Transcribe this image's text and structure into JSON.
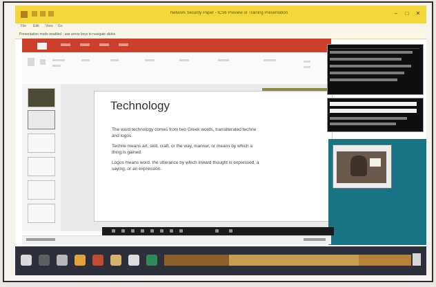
{
  "window": {
    "title": "Network Security Paper - ICS6 Preview or Training Presentation",
    "buttons": [
      "–",
      "□",
      "✕"
    ]
  },
  "menu": [
    "File",
    "Edit",
    "View",
    "Go"
  ],
  "infobar": {
    "text": "Presentation mode enabled - use arrow keys to navigate slides"
  },
  "slide": {
    "title": "Technology",
    "bullets": [
      "The word technology comes from two Greek words, transliterated techne and logos.",
      "Techne means art, skill, craft, or the way, manner, or means by which a thing is gained.",
      "Logos means word, the utterance by which inward thought is expressed, a saying, or an expression."
    ]
  },
  "colors": {
    "titlebar": "#f2d63a",
    "ribbon_tabs": "#cc3f2d",
    "olive": "#8a8944",
    "teal": "#187484",
    "taskbar": "#2d2f3a"
  }
}
